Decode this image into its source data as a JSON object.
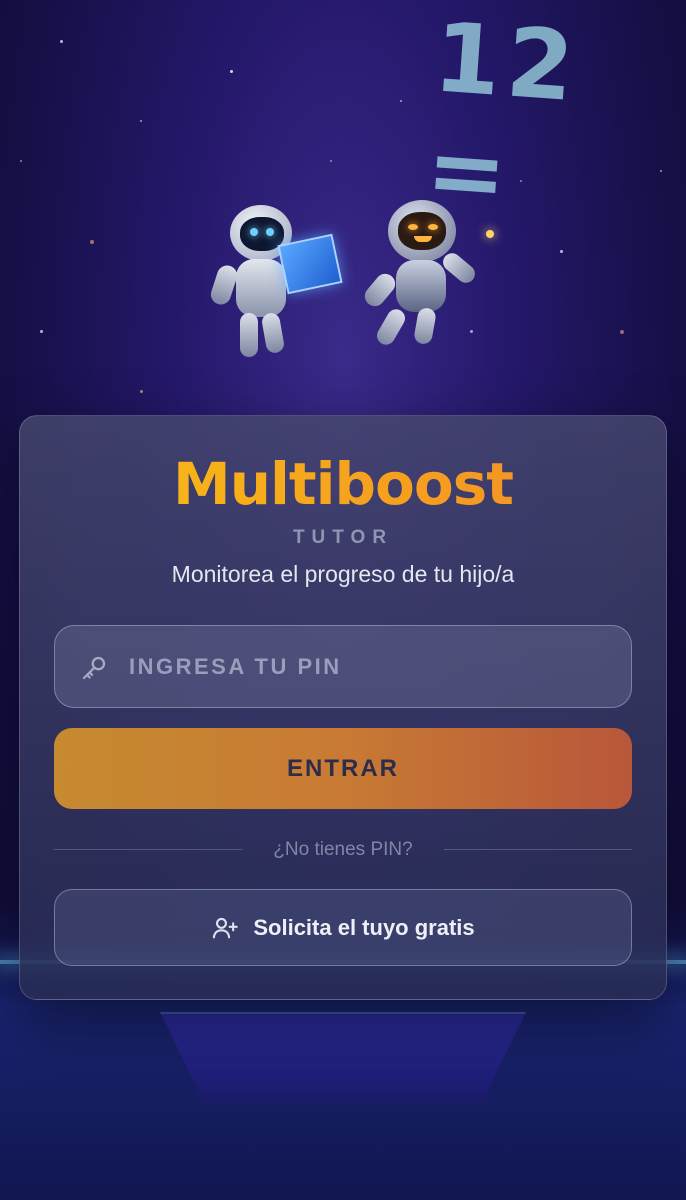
{
  "brand": {
    "name": "Multiboost",
    "subtitle": "TUTOR",
    "tagline": "Monitorea el progreso de tu hijo/a"
  },
  "pin": {
    "placeholder": "INGRESA TU PIN",
    "value": "",
    "icon": "key-icon"
  },
  "enter_button": {
    "label": "ENTRAR"
  },
  "divider": {
    "text": "¿No tienes PIN?"
  },
  "request_button": {
    "label": "Solicita el tuyo gratis",
    "icon": "user-plus-icon"
  },
  "background": {
    "numbers": [
      "12 ="
    ]
  },
  "colors": {
    "brand_start": "#f8c414",
    "brand_end": "#f08a2a",
    "enter_start": "#c68a30",
    "enter_end": "#b8573a"
  }
}
